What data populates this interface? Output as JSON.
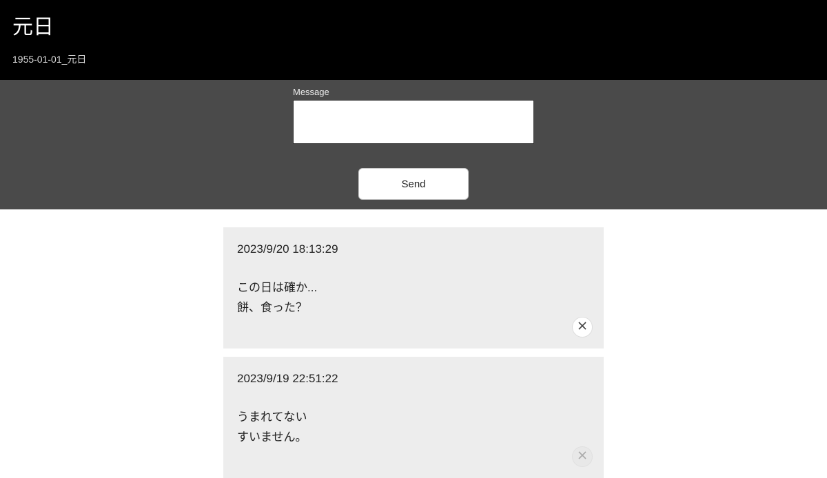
{
  "header": {
    "title": "元日",
    "subtitle": "1955-01-01_元日"
  },
  "compose": {
    "label": "Message",
    "value": "",
    "send_label": "Send"
  },
  "messages": [
    {
      "timestamp": "2023/9/20 18:13:29",
      "body": "この日は確か...\n餅、食った？",
      "close_dim": false
    },
    {
      "timestamp": "2023/9/19 22:51:22",
      "body": "うまれてない\nすいません。",
      "close_dim": true
    }
  ]
}
